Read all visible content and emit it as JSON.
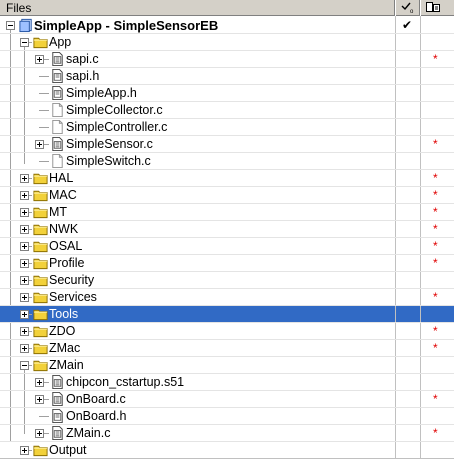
{
  "header": {
    "title": "Files",
    "col2_icon": "checkmark-column-icon",
    "col3_icon": "options-column-icon"
  },
  "colors": {
    "selection": "#316ac5",
    "modified_marker": "#e00000",
    "folder": "#f2d13a"
  },
  "rows": [
    {
      "label": "SimpleApp - SimpleSensorEB",
      "icon": "workspace-icon",
      "expander": "minus",
      "depth": 0,
      "bold": true,
      "check": "✔",
      "star": ""
    },
    {
      "label": "App",
      "icon": "folder-icon",
      "expander": "minus",
      "depth": 1,
      "check": "",
      "star": ""
    },
    {
      "label": "sapi.c",
      "icon": "source-file-icon",
      "expander": "plus",
      "depth": 2,
      "check": "",
      "star": "*"
    },
    {
      "label": "sapi.h",
      "icon": "header-file-icon",
      "expander": "",
      "depth": 2,
      "check": "",
      "star": ""
    },
    {
      "label": "SimpleApp.h",
      "icon": "header-file-icon",
      "expander": "",
      "depth": 2,
      "check": "",
      "star": ""
    },
    {
      "label": "SimpleCollector.c",
      "icon": "excluded-file-icon",
      "expander": "",
      "depth": 2,
      "check": "",
      "star": ""
    },
    {
      "label": "SimpleController.c",
      "icon": "excluded-file-icon",
      "expander": "",
      "depth": 2,
      "check": "",
      "star": ""
    },
    {
      "label": "SimpleSensor.c",
      "icon": "source-file-icon",
      "expander": "plus",
      "depth": 2,
      "check": "",
      "star": "*"
    },
    {
      "label": "SimpleSwitch.c",
      "icon": "excluded-file-icon",
      "expander": "",
      "depth": 2,
      "check": "",
      "star": ""
    },
    {
      "label": "HAL",
      "icon": "folder-icon",
      "expander": "plus",
      "depth": 1,
      "check": "",
      "star": "*"
    },
    {
      "label": "MAC",
      "icon": "folder-icon",
      "expander": "plus",
      "depth": 1,
      "check": "",
      "star": "*"
    },
    {
      "label": "MT",
      "icon": "folder-icon",
      "expander": "plus",
      "depth": 1,
      "check": "",
      "star": "*"
    },
    {
      "label": "NWK",
      "icon": "folder-icon",
      "expander": "plus",
      "depth": 1,
      "check": "",
      "star": "*"
    },
    {
      "label": "OSAL",
      "icon": "folder-icon",
      "expander": "plus",
      "depth": 1,
      "check": "",
      "star": "*"
    },
    {
      "label": "Profile",
      "icon": "folder-icon",
      "expander": "plus",
      "depth": 1,
      "check": "",
      "star": "*"
    },
    {
      "label": "Security",
      "icon": "folder-icon",
      "expander": "plus",
      "depth": 1,
      "check": "",
      "star": ""
    },
    {
      "label": "Services",
      "icon": "folder-icon",
      "expander": "plus",
      "depth": 1,
      "check": "",
      "star": "*"
    },
    {
      "label": "Tools",
      "icon": "folder-icon",
      "expander": "plus",
      "depth": 1,
      "check": "",
      "star": "",
      "selected": true
    },
    {
      "label": "ZDO",
      "icon": "folder-icon",
      "expander": "plus",
      "depth": 1,
      "check": "",
      "star": "*"
    },
    {
      "label": "ZMac",
      "icon": "folder-icon",
      "expander": "plus",
      "depth": 1,
      "check": "",
      "star": "*"
    },
    {
      "label": "ZMain",
      "icon": "folder-icon",
      "expander": "minus",
      "depth": 1,
      "check": "",
      "star": ""
    },
    {
      "label": "chipcon_cstartup.s51",
      "icon": "source-file-icon",
      "expander": "plus",
      "depth": 2,
      "check": "",
      "star": ""
    },
    {
      "label": "OnBoard.c",
      "icon": "source-file-icon",
      "expander": "plus",
      "depth": 2,
      "check": "",
      "star": "*"
    },
    {
      "label": "OnBoard.h",
      "icon": "header-file-icon",
      "expander": "",
      "depth": 2,
      "check": "",
      "star": ""
    },
    {
      "label": "ZMain.c",
      "icon": "source-file-icon",
      "expander": "plus",
      "depth": 2,
      "check": "",
      "star": "*"
    },
    {
      "label": "Output",
      "icon": "folder-icon",
      "expander": "plus",
      "depth": 1,
      "check": "",
      "star": ""
    }
  ]
}
